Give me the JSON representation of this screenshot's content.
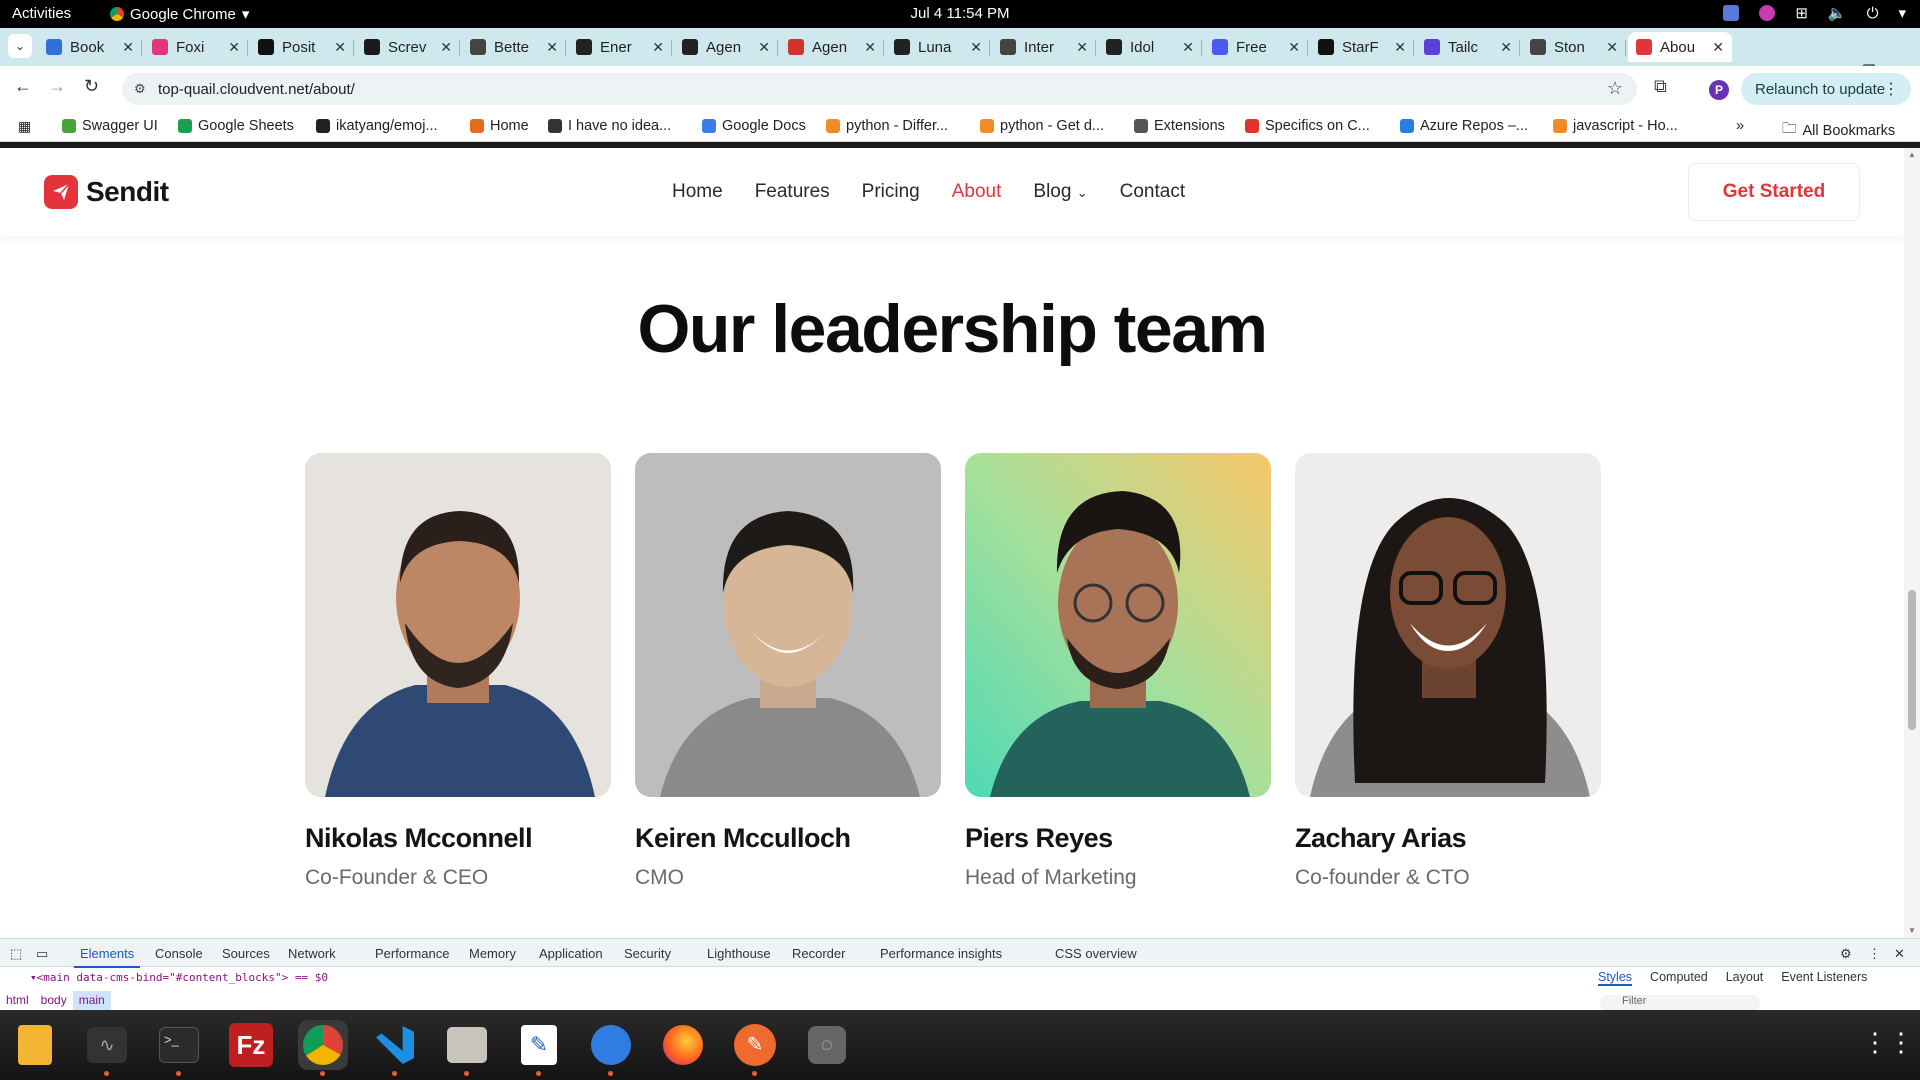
{
  "system": {
    "activities": "Activities",
    "app_name": "Google Chrome",
    "clock": "Jul 4  11:54 PM"
  },
  "tabs": [
    {
      "title": "Book",
      "color": "#2f6fe0"
    },
    {
      "title": "Foxi",
      "color": "#e2387a"
    },
    {
      "title": "Posit",
      "color": "#111111"
    },
    {
      "title": "Screv",
      "color": "#1a1a1a"
    },
    {
      "title": "Bette",
      "color": "#444444"
    },
    {
      "title": "Ener",
      "color": "#222222"
    },
    {
      "title": "Agen",
      "color": "#222222"
    },
    {
      "title": "Agen",
      "color": "#d1322b"
    },
    {
      "title": "Luna",
      "color": "#222222"
    },
    {
      "title": "Inter",
      "color": "#444444"
    },
    {
      "title": "Idol",
      "color": "#222222"
    },
    {
      "title": "Free",
      "color": "#4a5cf0"
    },
    {
      "title": "StarF",
      "color": "#111111"
    },
    {
      "title": "Tailc",
      "color": "#5b3fd6"
    },
    {
      "title": "Ston",
      "color": "#444444"
    },
    {
      "title": "Abou",
      "color": "#e5333b",
      "active": true
    }
  ],
  "toolbar": {
    "url": "top-quail.cloudvent.net/about/",
    "relaunch": "Relaunch to update",
    "profile_initial": "P"
  },
  "bookmarks": [
    {
      "label": "Swagger UI",
      "color": "#49a33a"
    },
    {
      "label": "Google Sheets",
      "color": "#1e9e4f"
    },
    {
      "label": "ikatyang/emoj...",
      "color": "#222222"
    },
    {
      "label": "Home",
      "color": "#e56b1f"
    },
    {
      "label": "I have no idea...",
      "color": "#333333"
    },
    {
      "label": "Google Docs",
      "color": "#3a7ce8"
    },
    {
      "label": "python - Differ...",
      "color": "#f08b2a"
    },
    {
      "label": "python - Get d...",
      "color": "#f08b2a"
    },
    {
      "label": "Extensions",
      "color": "#555555"
    },
    {
      "label": "Specifics on C...",
      "color": "#e0342a"
    },
    {
      "label": "Azure Repos –...",
      "color": "#2a7de1"
    },
    {
      "label": "javascript - Ho...",
      "color": "#f08b2a"
    }
  ],
  "all_bookmarks": "All Bookmarks",
  "site": {
    "brand": "Sendit",
    "accent": "#e5333b",
    "nav": [
      "Home",
      "Features",
      "Pricing",
      "About",
      "Blog",
      "Contact"
    ],
    "nav_active": "About",
    "cta": "Get Started",
    "heading": "Our leadership team",
    "team": [
      {
        "name": "Nikolas Mcconnell",
        "role": "Co-Founder & CEO"
      },
      {
        "name": "Keiren Mcculloch",
        "role": "CMO"
      },
      {
        "name": "Piers Reyes",
        "role": "Head of Marketing"
      },
      {
        "name": "Zachary Arias",
        "role": "Co-founder & CTO"
      }
    ]
  },
  "devtools": {
    "tabs": [
      "Elements",
      "Console",
      "Sources",
      "Network",
      "Performance",
      "Memory",
      "Application",
      "Security",
      "Lighthouse",
      "Recorder",
      "Performance insights",
      "CSS overview"
    ],
    "code": "▾<main data-cms-bind=\"#content_blocks\"> == $0",
    "crumbs": [
      "html",
      "body",
      "main"
    ],
    "side_tabs": [
      "Styles",
      "Computed",
      "Layout",
      "Event Listeners"
    ],
    "filter": "Filter"
  }
}
